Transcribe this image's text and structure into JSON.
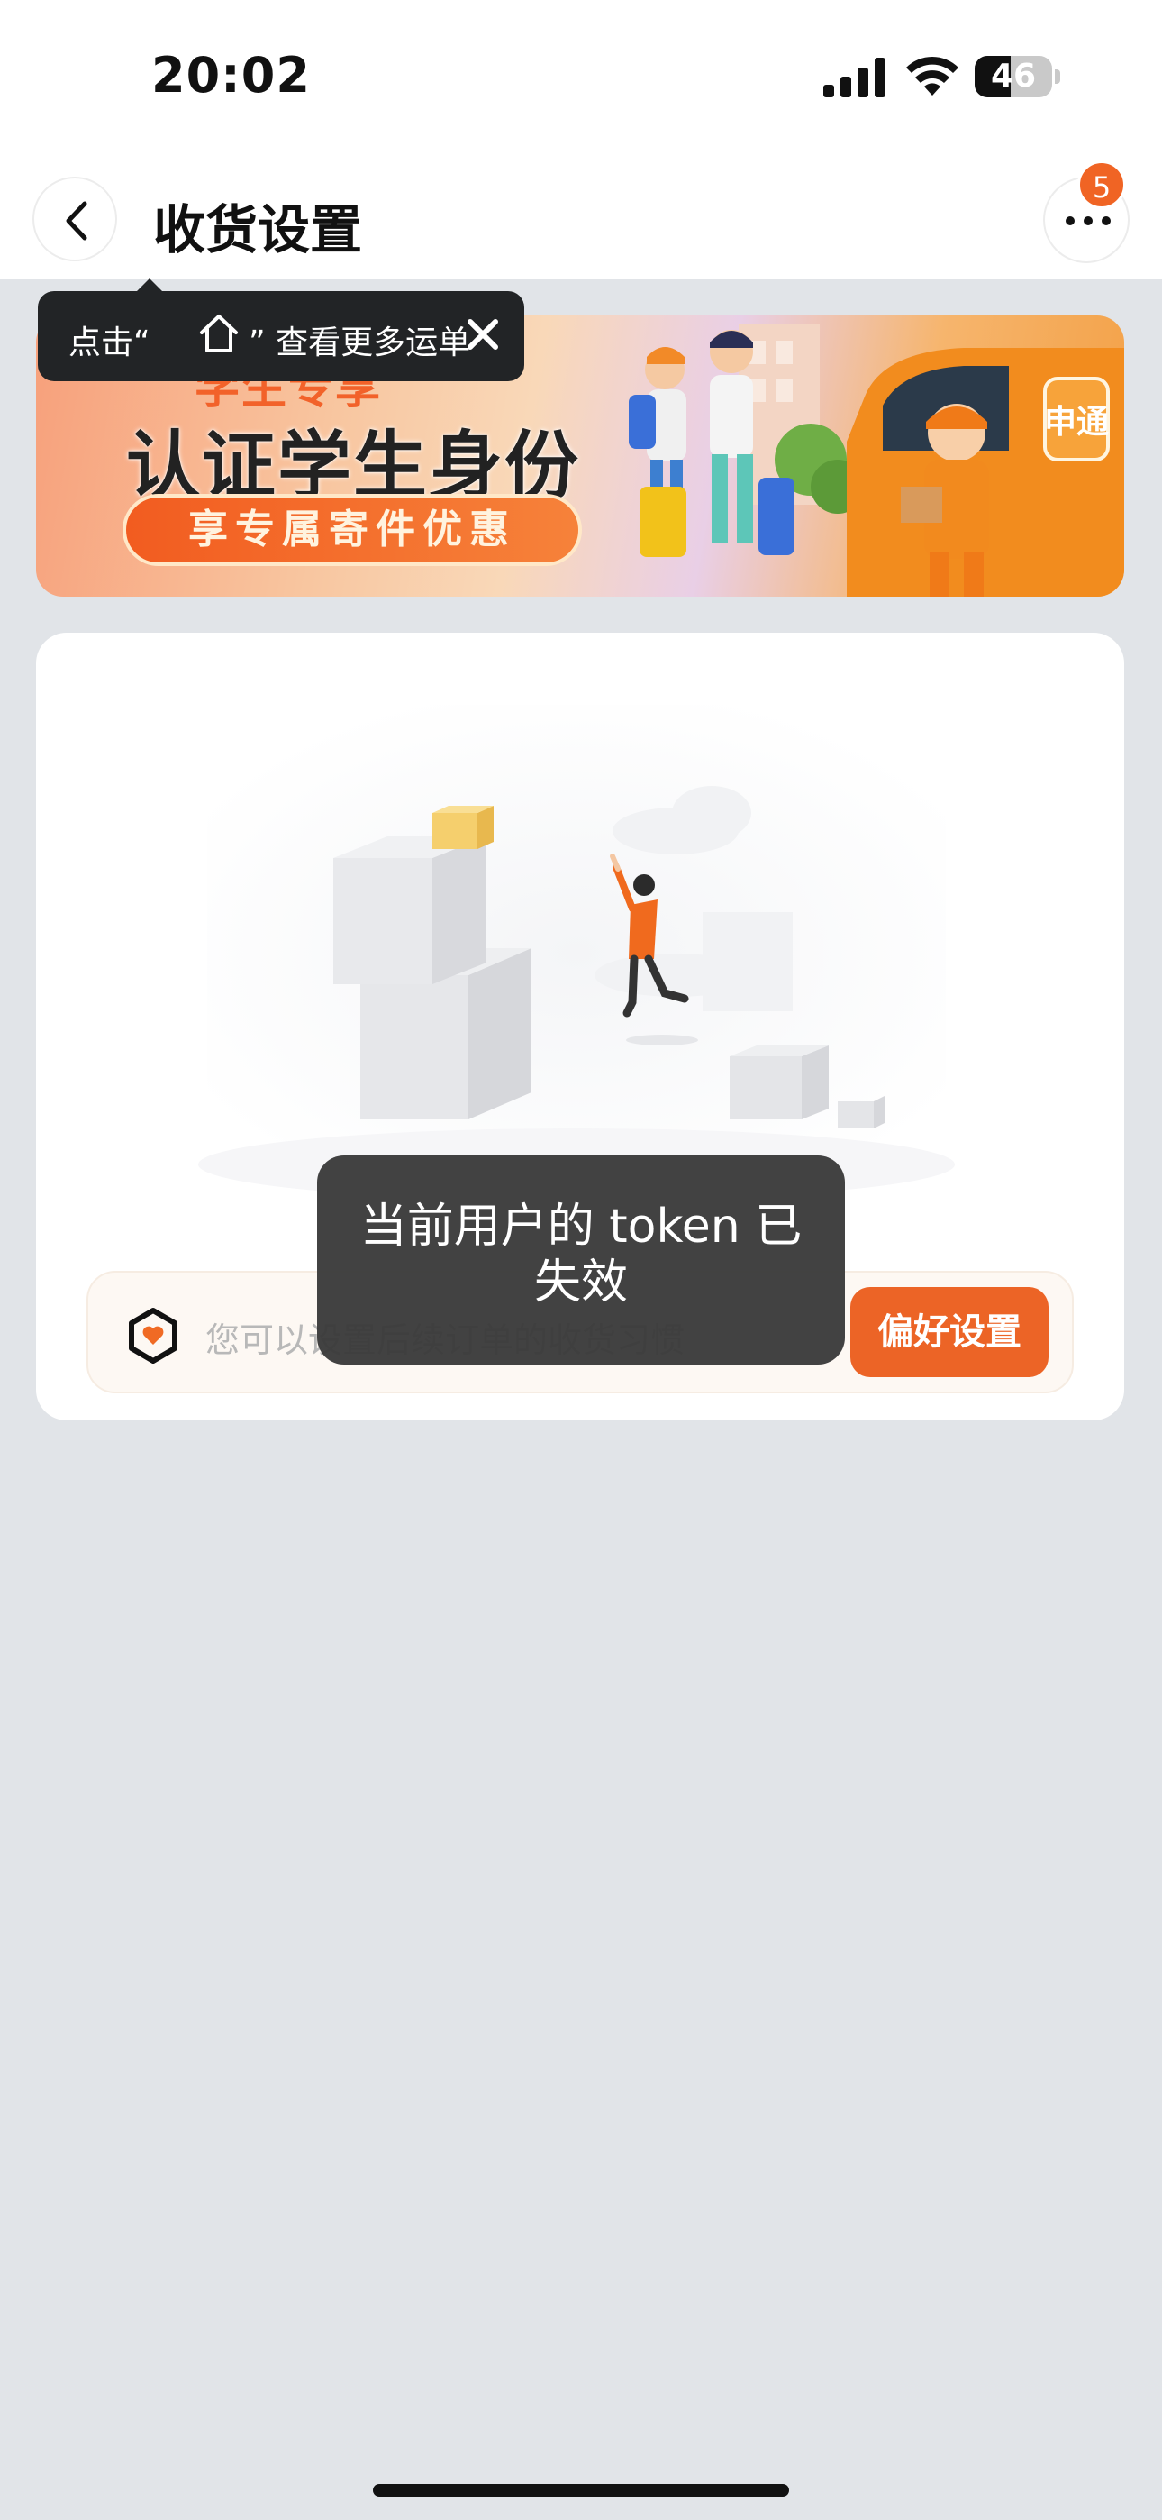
{
  "status_bar": {
    "time": "20:02",
    "battery": "46",
    "battery_level": 0.46,
    "icons": [
      "signal-icon",
      "wifi-icon",
      "battery-icon"
    ]
  },
  "nav": {
    "title": "收货设置",
    "back_icon": "chevron-left-icon",
    "more_icon": "more-dots-icon",
    "badge_count": "5"
  },
  "tooltip": {
    "text_prefix": "点击“",
    "home_icon": "home-icon",
    "text_suffix": "” 查看更多运单",
    "close_icon": "close-icon"
  },
  "banner": {
    "tag": "学生专享",
    "headline": "认证学生身份",
    "pill": "享专属寄件优惠",
    "van_text": "申通"
  },
  "card": {
    "illustration": "empty-boxes-illustration",
    "pref_icon": "heart-hexagon-icon",
    "pref_hint": "您可以设置后续订单的收货习惯",
    "pref_button": "偏好设置"
  },
  "toast": {
    "message": "当前用户的 token 已失效"
  },
  "colors": {
    "accent": "#ec6426",
    "badge": "#f06424",
    "page_bg": "#e1e4e8"
  }
}
